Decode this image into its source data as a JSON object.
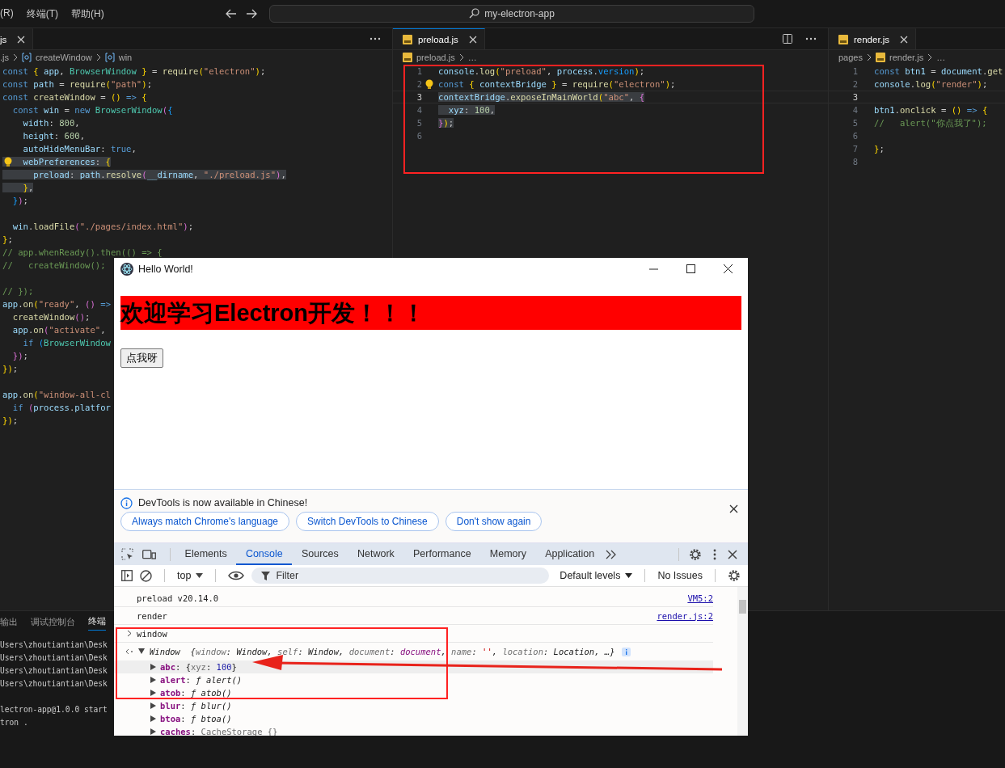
{
  "title_bar": {
    "menus": [
      "(R)",
      "终端(T)",
      "帮助(H)"
    ],
    "search": "my-electron-app"
  },
  "editor_groups": [
    {
      "tabs": [
        {
          "label": "js",
          "selected": true,
          "focused": false,
          "kind": "plain"
        }
      ],
      "actions": [
        {
          "kind": "more"
        }
      ],
      "breadcrumb": [
        {
          "text": ".js",
          "kind": "plain"
        },
        {
          "text": "createWindow",
          "kind": "symbol"
        },
        {
          "text": "win",
          "kind": "symbol"
        }
      ],
      "lines": [
        {
          "kind": "code",
          "highlighted": false,
          "lightbulb": false,
          "tokens": [
            {
              "text": "const",
              "kind": "kw"
            },
            {
              "text": " {",
              "kind": "gold"
            },
            {
              "text": " app",
              "kind": "var"
            },
            {
              "text": ", ",
              "kind": "punct"
            },
            {
              "text": "BrowserWindow",
              "kind": "type"
            },
            {
              "text": " }",
              "kind": "gold"
            },
            {
              "text": " = ",
              "kind": "punct"
            },
            {
              "text": "require",
              "kind": "fn"
            },
            {
              "text": "(",
              "kind": "gold"
            },
            {
              "text": "\"electron\"",
              "kind": "str"
            },
            {
              "text": ")",
              "kind": "gold"
            },
            {
              "text": ";",
              "kind": "punct"
            }
          ]
        },
        {
          "kind": "code",
          "highlighted": false,
          "lightbulb": false,
          "tokens": [
            {
              "text": "const",
              "kind": "kw"
            },
            {
              "text": " path",
              "kind": "var"
            },
            {
              "text": " = ",
              "kind": "punct"
            },
            {
              "text": "require",
              "kind": "fn"
            },
            {
              "text": "(",
              "kind": "gold"
            },
            {
              "text": "\"path\"",
              "kind": "str"
            },
            {
              "text": ")",
              "kind": "gold"
            },
            {
              "text": ";",
              "kind": "punct"
            }
          ]
        },
        {
          "kind": "code",
          "highlighted": false,
          "lightbulb": false,
          "tokens": [
            {
              "text": "const",
              "kind": "kw"
            },
            {
              "text": " createWindow",
              "kind": "fn"
            },
            {
              "text": " = ",
              "kind": "punct"
            },
            {
              "text": "()",
              "kind": "gold"
            },
            {
              "text": " =>",
              "kind": "kw"
            },
            {
              "text": " {",
              "kind": "gold"
            }
          ]
        },
        {
          "kind": "code",
          "highlighted": false,
          "lightbulb": false,
          "tokens": [
            {
              "text": "  const",
              "kind": "kw"
            },
            {
              "text": " win",
              "kind": "var"
            },
            {
              "text": " = ",
              "kind": "punct"
            },
            {
              "text": "new",
              "kind": "kw"
            },
            {
              "text": " BrowserWindow",
              "kind": "type"
            },
            {
              "text": "(",
              "kind": "pink"
            },
            {
              "text": "{",
              "kind": "blue"
            }
          ]
        },
        {
          "kind": "code",
          "highlighted": false,
          "lightbulb": false,
          "tokens": [
            {
              "text": "    width",
              "kind": "var"
            },
            {
              "text": ": ",
              "kind": "punct"
            },
            {
              "text": "800",
              "kind": "num"
            },
            {
              "text": ",",
              "kind": "punct"
            }
          ]
        },
        {
          "kind": "code",
          "highlighted": false,
          "lightbulb": false,
          "tokens": [
            {
              "text": "    height",
              "kind": "var"
            },
            {
              "text": ": ",
              "kind": "punct"
            },
            {
              "text": "600",
              "kind": "num"
            },
            {
              "text": ",",
              "kind": "punct"
            }
          ]
        },
        {
          "kind": "code",
          "highlighted": false,
          "lightbulb": false,
          "tokens": [
            {
              "text": "    autoHideMenuBar",
              "kind": "var"
            },
            {
              "text": ": ",
              "kind": "punct"
            },
            {
              "text": "true",
              "kind": "kw"
            },
            {
              "text": ",",
              "kind": "punct"
            }
          ]
        },
        {
          "kind": "code",
          "highlighted": true,
          "lightbulb": true,
          "tokens": [
            {
              "text": "    webPreferences",
              "kind": "var"
            },
            {
              "text": ": ",
              "kind": "punct"
            },
            {
              "text": "{",
              "kind": "gold"
            }
          ]
        },
        {
          "kind": "code",
          "highlighted": true,
          "lightbulb": false,
          "tokens": [
            {
              "text": "      preload",
              "kind": "var"
            },
            {
              "text": ": ",
              "kind": "punct"
            },
            {
              "text": "path",
              "kind": "var"
            },
            {
              "text": ".",
              "kind": "punct"
            },
            {
              "text": "resolve",
              "kind": "fn"
            },
            {
              "text": "(",
              "kind": "pink"
            },
            {
              "text": "__dirname",
              "kind": "var"
            },
            {
              "text": ", ",
              "kind": "punct"
            },
            {
              "text": "\"./preload.js\"",
              "kind": "str"
            },
            {
              "text": ")",
              "kind": "pink"
            },
            {
              "text": ",",
              "kind": "punct"
            }
          ]
        },
        {
          "kind": "code",
          "highlighted": true,
          "lightbulb": false,
          "tokens": [
            {
              "text": "    }",
              "kind": "gold"
            },
            {
              "text": ",",
              "kind": "punct"
            }
          ]
        },
        {
          "kind": "code",
          "highlighted": false,
          "lightbulb": false,
          "tokens": [
            {
              "text": "  }",
              "kind": "blue"
            },
            {
              "text": ")",
              "kind": "pink"
            },
            {
              "text": ";",
              "kind": "punct"
            }
          ]
        },
        {
          "kind": "blank"
        },
        {
          "kind": "code",
          "highlighted": false,
          "lightbulb": false,
          "tokens": [
            {
              "text": "  win",
              "kind": "var"
            },
            {
              "text": ".",
              "kind": "punct"
            },
            {
              "text": "loadFile",
              "kind": "fn"
            },
            {
              "text": "(",
              "kind": "pink"
            },
            {
              "text": "\"./pages/index.html\"",
              "kind": "str"
            },
            {
              "text": ")",
              "kind": "pink"
            },
            {
              "text": ";",
              "kind": "punct"
            }
          ]
        },
        {
          "kind": "code",
          "highlighted": false,
          "lightbulb": false,
          "tokens": [
            {
              "text": "}",
              "kind": "gold"
            },
            {
              "text": ";",
              "kind": "punct"
            }
          ]
        },
        {
          "kind": "code",
          "highlighted": false,
          "lightbulb": false,
          "tokens": [
            {
              "text": "// app.whenReady().then(() => {",
              "kind": "comment"
            }
          ]
        },
        {
          "kind": "code",
          "highlighted": false,
          "lightbulb": false,
          "tokens": [
            {
              "text": "//   createWindow();",
              "kind": "comment"
            }
          ]
        },
        {
          "kind": "blank"
        },
        {
          "kind": "code",
          "highlighted": false,
          "lightbulb": false,
          "tokens": [
            {
              "text": "// });",
              "kind": "comment"
            }
          ]
        },
        {
          "kind": "code",
          "highlighted": false,
          "lightbulb": false,
          "tokens": [
            {
              "text": "app",
              "kind": "var"
            },
            {
              "text": ".",
              "kind": "punct"
            },
            {
              "text": "on",
              "kind": "fn"
            },
            {
              "text": "(",
              "kind": "gold"
            },
            {
              "text": "\"ready\"",
              "kind": "str"
            },
            {
              "text": ", ",
              "kind": "punct"
            },
            {
              "text": "()",
              "kind": "pink"
            },
            {
              "text": " =>",
              "kind": "kw"
            }
          ]
        },
        {
          "kind": "code",
          "highlighted": false,
          "lightbulb": false,
          "tokens": [
            {
              "text": "  createWindow",
              "kind": "fn"
            },
            {
              "text": "()",
              "kind": "pink"
            },
            {
              "text": ";",
              "kind": "punct"
            }
          ]
        },
        {
          "kind": "code",
          "highlighted": false,
          "lightbulb": false,
          "tokens": [
            {
              "text": "  app",
              "kind": "var"
            },
            {
              "text": ".",
              "kind": "punct"
            },
            {
              "text": "on",
              "kind": "fn"
            },
            {
              "text": "(",
              "kind": "pink"
            },
            {
              "text": "\"activate\"",
              "kind": "str"
            },
            {
              "text": ",",
              "kind": "punct"
            }
          ]
        },
        {
          "kind": "code",
          "highlighted": false,
          "lightbulb": false,
          "tokens": [
            {
              "text": "    if",
              "kind": "kw"
            },
            {
              "text": " (",
              "kind": "blue"
            },
            {
              "text": "BrowserWindow",
              "kind": "type"
            }
          ]
        },
        {
          "kind": "code",
          "highlighted": false,
          "lightbulb": false,
          "tokens": [
            {
              "text": "  }",
              "kind": "pink"
            },
            {
              "text": ")",
              "kind": "pink"
            },
            {
              "text": ";",
              "kind": "punct"
            }
          ]
        },
        {
          "kind": "code",
          "highlighted": false,
          "lightbulb": false,
          "tokens": [
            {
              "text": "}",
              "kind": "gold"
            },
            {
              "text": ")",
              "kind": "gold"
            },
            {
              "text": ";",
              "kind": "punct"
            }
          ]
        },
        {
          "kind": "blank"
        },
        {
          "kind": "code",
          "highlighted": false,
          "lightbulb": false,
          "tokens": [
            {
              "text": "app",
              "kind": "var"
            },
            {
              "text": ".",
              "kind": "punct"
            },
            {
              "text": "on",
              "kind": "fn"
            },
            {
              "text": "(",
              "kind": "gold"
            },
            {
              "text": "\"window-all-cl",
              "kind": "str"
            }
          ]
        },
        {
          "kind": "code",
          "highlighted": false,
          "lightbulb": false,
          "tokens": [
            {
              "text": "  if",
              "kind": "kw"
            },
            {
              "text": " (",
              "kind": "pink"
            },
            {
              "text": "process",
              "kind": "var"
            },
            {
              "text": ".",
              "kind": "punct"
            },
            {
              "text": "platfor",
              "kind": "var"
            }
          ]
        },
        {
          "kind": "code",
          "highlighted": false,
          "lightbulb": false,
          "tokens": [
            {
              "text": "}",
              "kind": "gold"
            },
            {
              "text": ")",
              "kind": "gold"
            },
            {
              "text": ";",
              "kind": "punct"
            }
          ]
        }
      ]
    },
    {
      "tabs": [
        {
          "label": "preload.js",
          "selected": true,
          "focused": true,
          "kind": "script"
        }
      ],
      "actions": [
        {
          "kind": "split"
        },
        {
          "kind": "more"
        }
      ],
      "breadcrumb": [
        {
          "text": "preload.js",
          "kind": "file"
        },
        {
          "text": "…",
          "kind": "plain"
        }
      ],
      "lines": [
        {
          "kind": "code",
          "number": "1",
          "current": false,
          "highlighted": false,
          "lightbulb": false,
          "tokens": [
            {
              "text": "console",
              "kind": "var"
            },
            {
              "text": ".",
              "kind": "punct"
            },
            {
              "text": "log",
              "kind": "fn"
            },
            {
              "text": "(",
              "kind": "gold"
            },
            {
              "text": "\"preload\"",
              "kind": "str"
            },
            {
              "text": ", ",
              "kind": "punct"
            },
            {
              "text": "process",
              "kind": "var"
            },
            {
              "text": ".",
              "kind": "punct"
            },
            {
              "text": "version",
              "kind": "blue"
            },
            {
              "text": ")",
              "kind": "gold"
            },
            {
              "text": ";",
              "kind": "punct"
            }
          ]
        },
        {
          "kind": "code",
          "number": "2",
          "current": false,
          "highlighted": false,
          "lightbulb": true,
          "tokens": [
            {
              "text": "const",
              "kind": "kw"
            },
            {
              "text": " {",
              "kind": "gold"
            },
            {
              "text": " contextBridge",
              "kind": "var"
            },
            {
              "text": " }",
              "kind": "gold"
            },
            {
              "text": " = ",
              "kind": "punct"
            },
            {
              "text": "require",
              "kind": "fn"
            },
            {
              "text": "(",
              "kind": "gold"
            },
            {
              "text": "\"electron\"",
              "kind": "str"
            },
            {
              "text": ")",
              "kind": "gold"
            },
            {
              "text": ";",
              "kind": "punct"
            }
          ]
        },
        {
          "kind": "code",
          "number": "3",
          "current": true,
          "highlighted": true,
          "lightbulb": false,
          "tokens": [
            {
              "text": "contextBridge",
              "kind": "var"
            },
            {
              "text": ".",
              "kind": "punct"
            },
            {
              "text": "exposeInMainWorld",
              "kind": "fn"
            },
            {
              "text": "(",
              "kind": "gold"
            },
            {
              "text": "\"abc\"",
              "kind": "str"
            },
            {
              "text": ", ",
              "kind": "punct"
            },
            {
              "text": "{",
              "kind": "pink"
            }
          ]
        },
        {
          "kind": "code",
          "number": "4",
          "current": false,
          "highlighted": true,
          "lightbulb": false,
          "tokens": [
            {
              "text": "  xyz",
              "kind": "var"
            },
            {
              "text": ": ",
              "kind": "punct"
            },
            {
              "text": "100",
              "kind": "num"
            },
            {
              "text": ",",
              "kind": "punct"
            }
          ]
        },
        {
          "kind": "code",
          "number": "5",
          "current": false,
          "highlighted": true,
          "lightbulb": false,
          "tokens": [
            {
              "text": "}",
              "kind": "pink"
            },
            {
              "text": ")",
              "kind": "gold"
            },
            {
              "text": ";",
              "kind": "punct"
            }
          ]
        },
        {
          "kind": "blank",
          "number": "6",
          "current": false
        }
      ]
    },
    {
      "tabs": [
        {
          "label": "render.js",
          "selected": true,
          "focused": false,
          "kind": "script"
        }
      ],
      "breadcrumb": [
        {
          "text": "pages",
          "kind": "plain"
        },
        {
          "text": "render.js",
          "kind": "file"
        },
        {
          "text": "…",
          "kind": "plain"
        }
      ],
      "lines": [
        {
          "kind": "code",
          "number": "1",
          "current": false,
          "highlighted": false,
          "lightbulb": false,
          "tokens": [
            {
              "text": "const",
              "kind": "kw"
            },
            {
              "text": " btn1",
              "kind": "var"
            },
            {
              "text": " = ",
              "kind": "punct"
            },
            {
              "text": "document",
              "kind": "var"
            },
            {
              "text": ".",
              "kind": "punct"
            },
            {
              "text": "get",
              "kind": "fn"
            }
          ]
        },
        {
          "kind": "code",
          "number": "2",
          "current": false,
          "highlighted": false,
          "lightbulb": false,
          "tokens": [
            {
              "text": "console",
              "kind": "var"
            },
            {
              "text": ".",
              "kind": "punct"
            },
            {
              "text": "log",
              "kind": "fn"
            },
            {
              "text": "(",
              "kind": "gold"
            },
            {
              "text": "\"render\"",
              "kind": "str"
            },
            {
              "text": ")",
              "kind": "gold"
            },
            {
              "text": ";",
              "kind": "punct"
            }
          ]
        },
        {
          "kind": "blank",
          "number": "3",
          "current": true
        },
        {
          "kind": "code",
          "number": "4",
          "current": false,
          "highlighted": false,
          "lightbulb": false,
          "tokens": [
            {
              "text": "btn1",
              "kind": "var"
            },
            {
              "text": ".",
              "kind": "punct"
            },
            {
              "text": "onclick",
              "kind": "fn"
            },
            {
              "text": " = ",
              "kind": "punct"
            },
            {
              "text": "()",
              "kind": "gold"
            },
            {
              "text": " =>",
              "kind": "kw"
            },
            {
              "text": " {",
              "kind": "gold"
            }
          ]
        },
        {
          "kind": "code",
          "number": "5",
          "current": false,
          "highlighted": false,
          "lightbulb": false,
          "tokens": [
            {
              "text": "//   alert(\"你点我了\");",
              "kind": "comment"
            }
          ]
        },
        {
          "kind": "blank",
          "number": "6",
          "current": false
        },
        {
          "kind": "code",
          "number": "7",
          "current": false,
          "highlighted": false,
          "lightbulb": false,
          "tokens": [
            {
              "text": "}",
              "kind": "gold"
            },
            {
              "text": ";",
              "kind": "punct"
            }
          ]
        },
        {
          "kind": "blank",
          "number": "8",
          "current": false
        }
      ]
    }
  ],
  "panel": {
    "tabs": [
      {
        "label": "输出",
        "selected": false
      },
      {
        "label": "调试控制台",
        "selected": false
      },
      {
        "label": "终端",
        "selected": true
      }
    ],
    "terminal_blocks": [
      [
        "Users\\zhoutiantian\\Desk",
        "Users\\zhoutiantian\\Desk",
        "Users\\zhoutiantian\\Desk",
        "Users\\zhoutiantian\\Desk"
      ],
      [
        "lectron-app@1.0.0 start",
        "tron ."
      ]
    ]
  },
  "app_window": {
    "title": "Hello World!",
    "heading": "欢迎学习Electron开发！！！",
    "button": "点我呀",
    "devtools": {
      "infobar": {
        "message": "DevTools is now available in Chinese!",
        "buttons": [
          "Always match Chrome's language",
          "Switch DevTools to Chinese",
          "Don't show again"
        ]
      },
      "tabs": [
        {
          "label": "Elements",
          "selected": false
        },
        {
          "label": "Console",
          "selected": true
        },
        {
          "label": "Sources",
          "selected": false
        },
        {
          "label": "Network",
          "selected": false
        },
        {
          "label": "Performance",
          "selected": false
        },
        {
          "label": "Memory",
          "selected": false
        },
        {
          "label": "Application",
          "selected": false
        }
      ],
      "toolbar": {
        "context": "top",
        "filter_placeholder": "Filter",
        "levels": "Default levels",
        "issues": "No Issues"
      },
      "console": [
        {
          "kind": "log",
          "text": "preload v20.14.0",
          "source": "VM5:2"
        },
        {
          "kind": "log",
          "text": "render",
          "source": "render.js:2"
        },
        {
          "kind": "input",
          "text": "window"
        },
        {
          "kind": "result",
          "expanded": true,
          "tokens": [
            {
              "text": "Window",
              "kind": "italic"
            },
            {
              "text": "  {",
              "kind": "punct"
            },
            {
              "text": "window",
              "kind": "grey"
            },
            {
              "text": ": ",
              "kind": "punct"
            },
            {
              "text": "Window",
              "kind": "italic"
            },
            {
              "text": ", ",
              "kind": "punct"
            },
            {
              "text": "self",
              "kind": "grey"
            },
            {
              "text": ": ",
              "kind": "punct"
            },
            {
              "text": "Window",
              "kind": "italic"
            },
            {
              "text": ", ",
              "kind": "punct"
            },
            {
              "text": "document",
              "kind": "grey"
            },
            {
              "text": ": ",
              "kind": "punct"
            },
            {
              "text": "document",
              "kind": "object"
            },
            {
              "text": ", ",
              "kind": "punct"
            },
            {
              "text": "name",
              "kind": "grey"
            },
            {
              "text": ": ",
              "kind": "punct"
            },
            {
              "text": "''",
              "kind": "str"
            },
            {
              "text": ", ",
              "kind": "punct"
            },
            {
              "text": "location",
              "kind": "grey"
            },
            {
              "text": ": ",
              "kind": "punct"
            },
            {
              "text": "Location",
              "kind": "italic"
            },
            {
              "text": ", ",
              "kind": "punct"
            },
            {
              "text": "…}",
              "kind": "punct"
            }
          ]
        },
        {
          "kind": "prop",
          "expanded": false,
          "selected": true,
          "tokens": [
            {
              "text": "abc",
              "kind": "name"
            },
            {
              "text": ": ",
              "kind": "punct"
            },
            {
              "text": "{",
              "kind": "punct"
            },
            {
              "text": "xyz",
              "kind": "grey"
            },
            {
              "text": ": ",
              "kind": "punct"
            },
            {
              "text": "100",
              "kind": "num"
            },
            {
              "text": "}",
              "kind": "punct"
            }
          ]
        },
        {
          "kind": "prop",
          "expanded": false,
          "selected": false,
          "tokens": [
            {
              "text": "alert",
              "kind": "name"
            },
            {
              "text": ": ",
              "kind": "punct"
            },
            {
              "text": "ƒ alert()",
              "kind": "italic"
            }
          ]
        },
        {
          "kind": "prop",
          "expanded": false,
          "selected": false,
          "tokens": [
            {
              "text": "atob",
              "kind": "name"
            },
            {
              "text": ": ",
              "kind": "punct"
            },
            {
              "text": "ƒ atob()",
              "kind": "italic"
            }
          ]
        },
        {
          "kind": "prop",
          "expanded": false,
          "selected": false,
          "tokens": [
            {
              "text": "blur",
              "kind": "name"
            },
            {
              "text": ": ",
              "kind": "punct"
            },
            {
              "text": "ƒ blur()",
              "kind": "italic"
            }
          ]
        },
        {
          "kind": "prop",
          "expanded": false,
          "selected": false,
          "tokens": [
            {
              "text": "btoa",
              "kind": "name"
            },
            {
              "text": ": ",
              "kind": "punct"
            },
            {
              "text": "ƒ btoa()",
              "kind": "italic"
            }
          ]
        },
        {
          "kind": "prop",
          "expanded": false,
          "selected": false,
          "tokens": [
            {
              "text": "caches",
              "kind": "name"
            },
            {
              "text": ": ",
              "kind": "punct"
            },
            {
              "text": "CacheStorage {}",
              "kind": "grey"
            }
          ]
        }
      ]
    }
  },
  "annotations": [
    {
      "kind": "box"
    },
    {
      "kind": "box"
    },
    {
      "kind": "arrow"
    }
  ]
}
